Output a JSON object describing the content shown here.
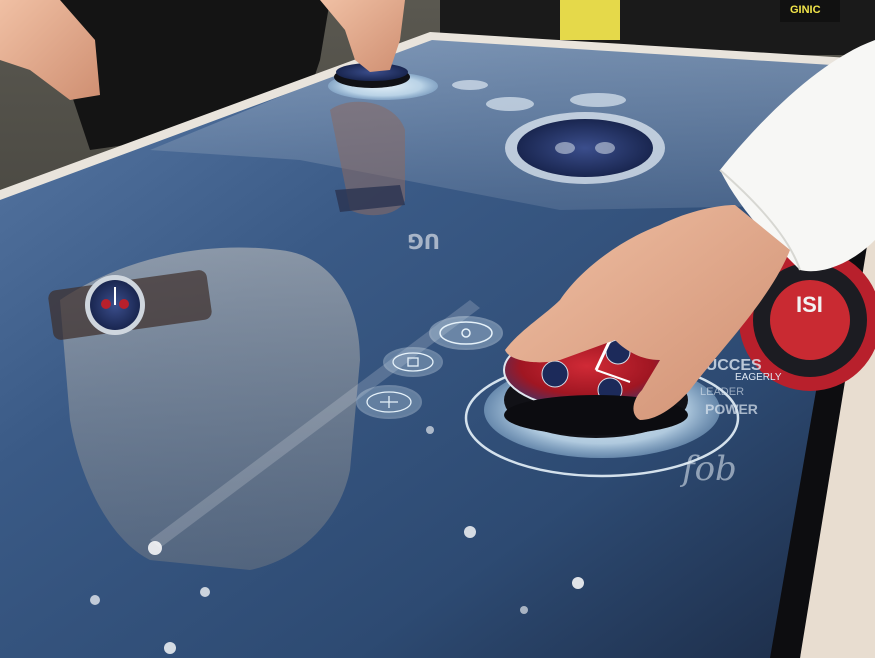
{
  "scene": {
    "description_label": "Interactive touch table with physical watch pucks",
    "sign_top_right": "GINIC",
    "mirrored_reflection_text": "UG"
  },
  "table": {
    "right_panel_words": [
      "SUCCES",
      "POWER",
      "LEADER"
    ],
    "dial_badge_text": "ISI",
    "dial_arc_text": "EAGERLY",
    "bottom_right_script": "fob"
  },
  "menu_buttons": [
    {
      "name": "menu-button-top",
      "icon": "watch-icon"
    },
    {
      "name": "menu-button-middle",
      "icon": "strap-icon"
    },
    {
      "name": "menu-button-bottom",
      "icon": "crown-icon"
    }
  ],
  "colors": {
    "table_glass": "#3a5a86",
    "table_glass_dark": "#1b2a44",
    "ring_glow": "#cfe6f5",
    "watch_dial_red": "#b8202c",
    "watch_dial_blue": "#1f2f63",
    "wood_frame": "#e8ddd0",
    "skin": "#e3a98b"
  }
}
